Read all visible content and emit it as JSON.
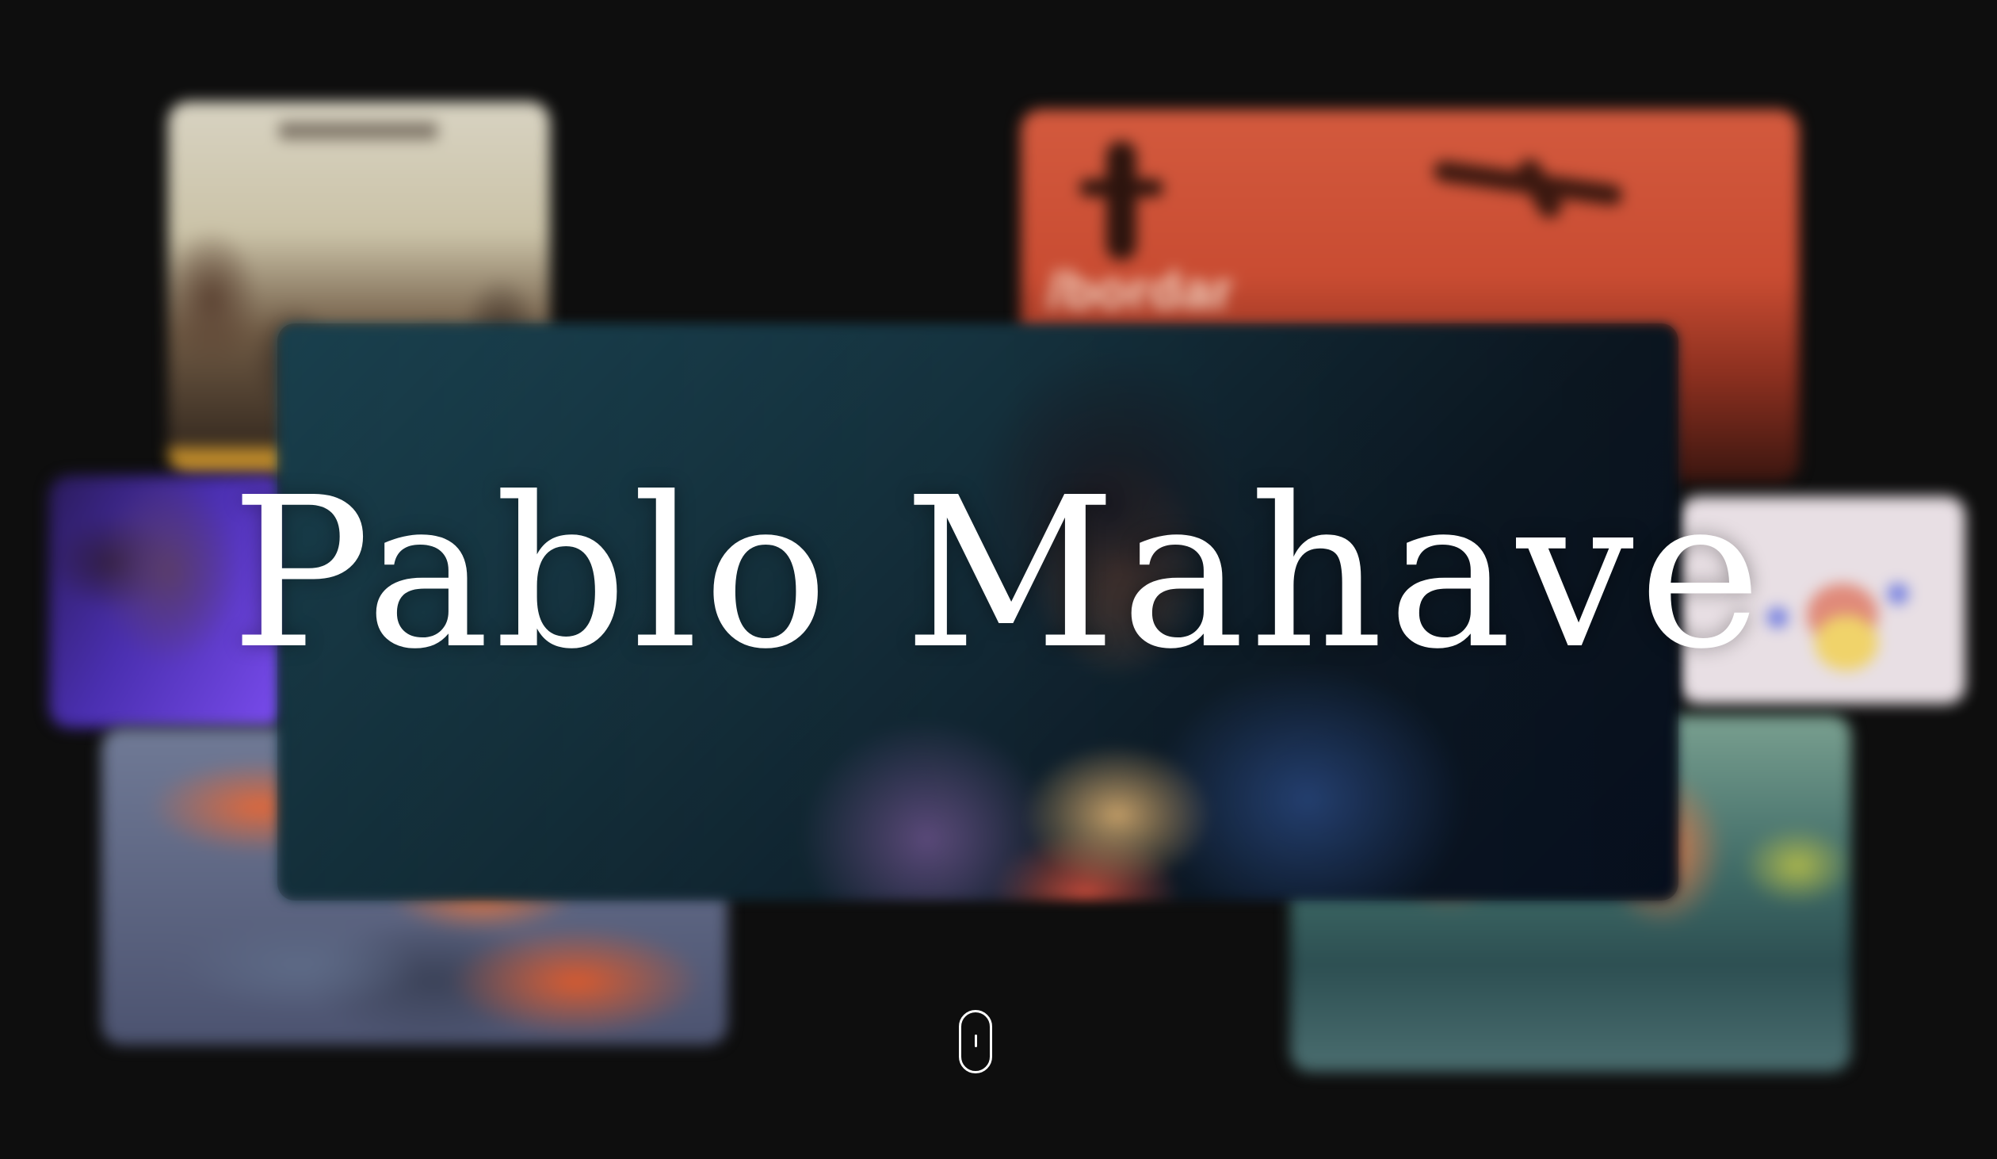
{
  "hero": {
    "title": "Pablo Mahave"
  },
  "gallery": {
    "tiles": [
      {
        "subject": "band-photo"
      },
      {
        "subject": "poster",
        "text": "/bordar"
      },
      {
        "subject": "portrait"
      },
      {
        "subject": "illustration"
      },
      {
        "subject": "mechanical-render"
      },
      {
        "subject": "seascape"
      }
    ]
  },
  "scroll_indicator": {
    "icon": "mouse-scroll-icon"
  },
  "colors": {
    "background": "#0e0e0e",
    "title": "#ffffff"
  }
}
